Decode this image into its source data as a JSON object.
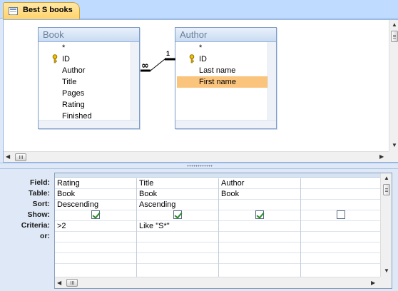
{
  "tab": {
    "label": "Best S books"
  },
  "tables": [
    {
      "title": "Book",
      "fields": [
        "*",
        "ID",
        "Author",
        "Title",
        "Pages",
        "Rating",
        "Finished"
      ],
      "key_field": "ID"
    },
    {
      "title": "Author",
      "fields": [
        "*",
        "ID",
        "Last name",
        "First name"
      ],
      "key_field": "ID",
      "selected": "First name"
    }
  ],
  "relationship": {
    "many_label": "∞",
    "one_label": "1"
  },
  "grid": {
    "row_labels": [
      "Field:",
      "Table:",
      "Sort:",
      "Show:",
      "Criteria:",
      "or:"
    ],
    "columns": [
      {
        "field": "Rating",
        "table": "Book",
        "sort": "Descending",
        "show": true,
        "criteria": ">2"
      },
      {
        "field": "Title",
        "table": "Book",
        "sort": "Ascending",
        "show": true,
        "criteria": "Like \"S*\""
      },
      {
        "field": "Author",
        "table": "Book",
        "sort": "",
        "show": true,
        "criteria": ""
      },
      {
        "field": "",
        "table": "",
        "sort": "",
        "show": false,
        "criteria": ""
      }
    ]
  },
  "colors": {
    "selected_field": "#fbc47c",
    "tab_active": "#ffd26a",
    "pane_border": "#8db2e3"
  }
}
